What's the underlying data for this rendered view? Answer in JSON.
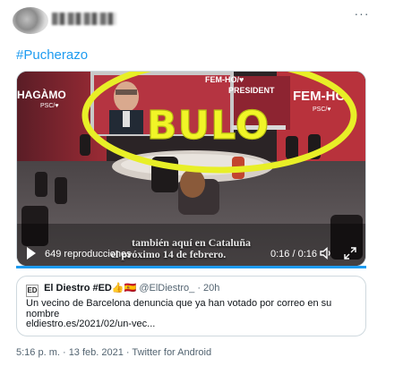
{
  "tweet": {
    "hashtag": "#Pucherazo",
    "more_icon": "more-horizontal-icon",
    "footer": "5:16 p. m. · 13 feb. 2021 · Twitter for Android"
  },
  "video": {
    "screen_text": "FEM-HO/♥",
    "slogan_left_line1": "HAGÀMO",
    "slogan_left_sub": "PSC/♥",
    "slogan_right_line1": "PRESIDENT",
    "slogan_right_big": "FEM-HO",
    "slogan_right_sub": "PSC/♥",
    "stamp": "BULO",
    "caption_line1": "también aquí en Cataluña",
    "caption_line2": "el próximo 14 de febrero.",
    "views": "649 reproducciones",
    "time": "0:16 / 0:16",
    "progress": 1.0,
    "accent": "#1d9bf0",
    "stamp_color": "#e8ef27"
  },
  "quote": {
    "logo": "ED",
    "name": "El Diestro #ED👍🇪🇸",
    "handle": "@ElDiestro_",
    "age": "· 20h",
    "text": "Un vecino de Barcelona denuncia que ya han votado por correo en su nombre",
    "link": "eldiestro.es/2021/02/un-vec..."
  }
}
